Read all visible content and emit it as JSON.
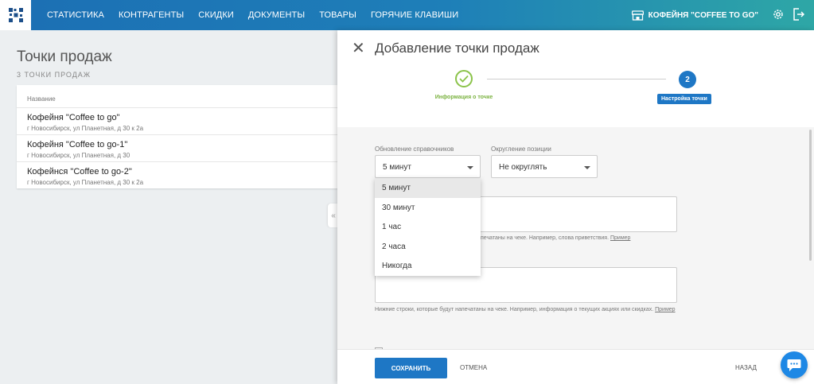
{
  "nav": {
    "items": [
      "СТАТИСТИКА",
      "КОНТРАГЕНТЫ",
      "СКИДКИ",
      "ДОКУМЕНТЫ",
      "ТОВАРЫ",
      "ГОРЯЧИЕ КЛАВИШИ"
    ],
    "store_name": "КОФЕЙНЯ \"COFFEE TO GO\""
  },
  "page": {
    "title": "Точки продаж",
    "subtitle": "3 ТОЧКИ ПРОДАЖ",
    "table_header": "Название",
    "rows": [
      {
        "name": "Кофейня \"Coffee to go\"",
        "address": "г Новосибирск, ул Планетная, д 30 к 2а"
      },
      {
        "name": "Кофейня \"Coffee to go-1\"",
        "address": "г Новосибирск, ул Планетная, д 30"
      },
      {
        "name": "Кофейнся \"Coffee to go-2\"",
        "address": "г Новосибирск, ул Планетная, д 30 к 2а"
      }
    ],
    "collapse_glyph": "«"
  },
  "panel": {
    "close_glyph": "✕",
    "title": "Добавление точки продаж",
    "step1_label": "Информация о точке",
    "step2_number": "2",
    "step2_label": "Настройка точки",
    "update_label": "Обновление справочников",
    "update_value": "5 минут",
    "rounding_label": "Округление позиции",
    "rounding_value": "Не округлять",
    "dropdown_options": [
      "5 минут",
      "30 минут",
      "1 час",
      "2 часа",
      "Никогда"
    ],
    "header_hint": "печатаны на чеке. Например, слова приветствия.",
    "footer_hint": "Нижние строки, которые будут напечатаны на чеке. Например, информация о текущих акциях или скидках.",
    "example_link": "Пример",
    "save": "СОХРАНИТЬ",
    "cancel": "ОТМЕНА",
    "back": "НАЗАД"
  },
  "colors": {
    "primary": "#1e77c5",
    "success": "#8bc34a"
  }
}
